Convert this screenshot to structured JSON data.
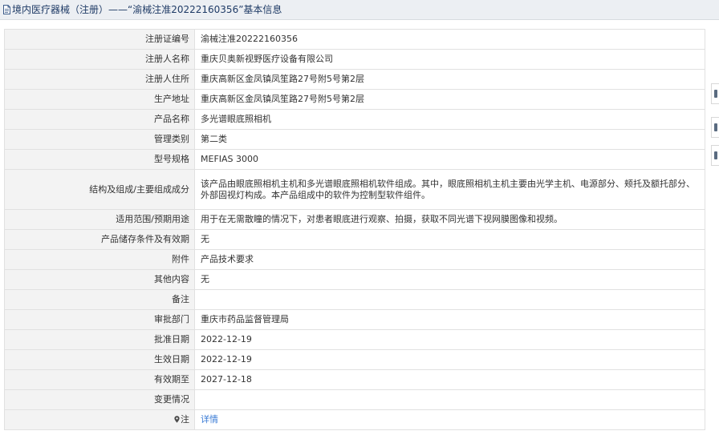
{
  "header": {
    "title": "境内医疗器械（注册）——“渝械注准20222160356”基本信息"
  },
  "rows": [
    {
      "label": "注册证编号",
      "value": "渝械注准20222160356"
    },
    {
      "label": "注册人名称",
      "value": "重庆贝奥新视野医疗设备有限公司"
    },
    {
      "label": "注册人住所",
      "value": "重庆高新区金凤镇凤笙路27号附5号第2层"
    },
    {
      "label": "生产地址",
      "value": "重庆高新区金凤镇凤笙路27号附5号第2层"
    },
    {
      "label": "产品名称",
      "value": "多光谱眼底照相机"
    },
    {
      "label": "管理类别",
      "value": "第二类"
    },
    {
      "label": "型号规格",
      "value": "MEFIAS 3000"
    },
    {
      "label": "结构及组成/主要组成成分",
      "value": "该产品由眼底照相机主机和多光谱眼底照相机软件组成。其中，眼底照相机主机主要由光学主机、电源部分、颊托及额托部分、外部固视灯构成。本产品组成中的软件为控制型软件组件。"
    },
    {
      "label": "适用范围/预期用途",
      "value": "用于在无需散瞳的情况下，对患者眼底进行观察、拍摄，获取不同光谱下视网膜图像和视频。"
    },
    {
      "label": "产品储存条件及有效期",
      "value": "无"
    },
    {
      "label": "附件",
      "value": "产品技术要求"
    },
    {
      "label": "其他内容",
      "value": "无"
    },
    {
      "label": "备注",
      "value": ""
    },
    {
      "label": "审批部门",
      "value": "重庆市药品监督管理局"
    },
    {
      "label": "批准日期",
      "value": "2022-12-19"
    },
    {
      "label": "生效日期",
      "value": "2022-12-19"
    },
    {
      "label": "有效期至",
      "value": "2027-12-18"
    },
    {
      "label": "变更情况",
      "value": ""
    }
  ],
  "note": {
    "label": "注",
    "link_text": "详情"
  },
  "icons": {
    "header": "document-icon",
    "note": "location-pin-icon"
  }
}
